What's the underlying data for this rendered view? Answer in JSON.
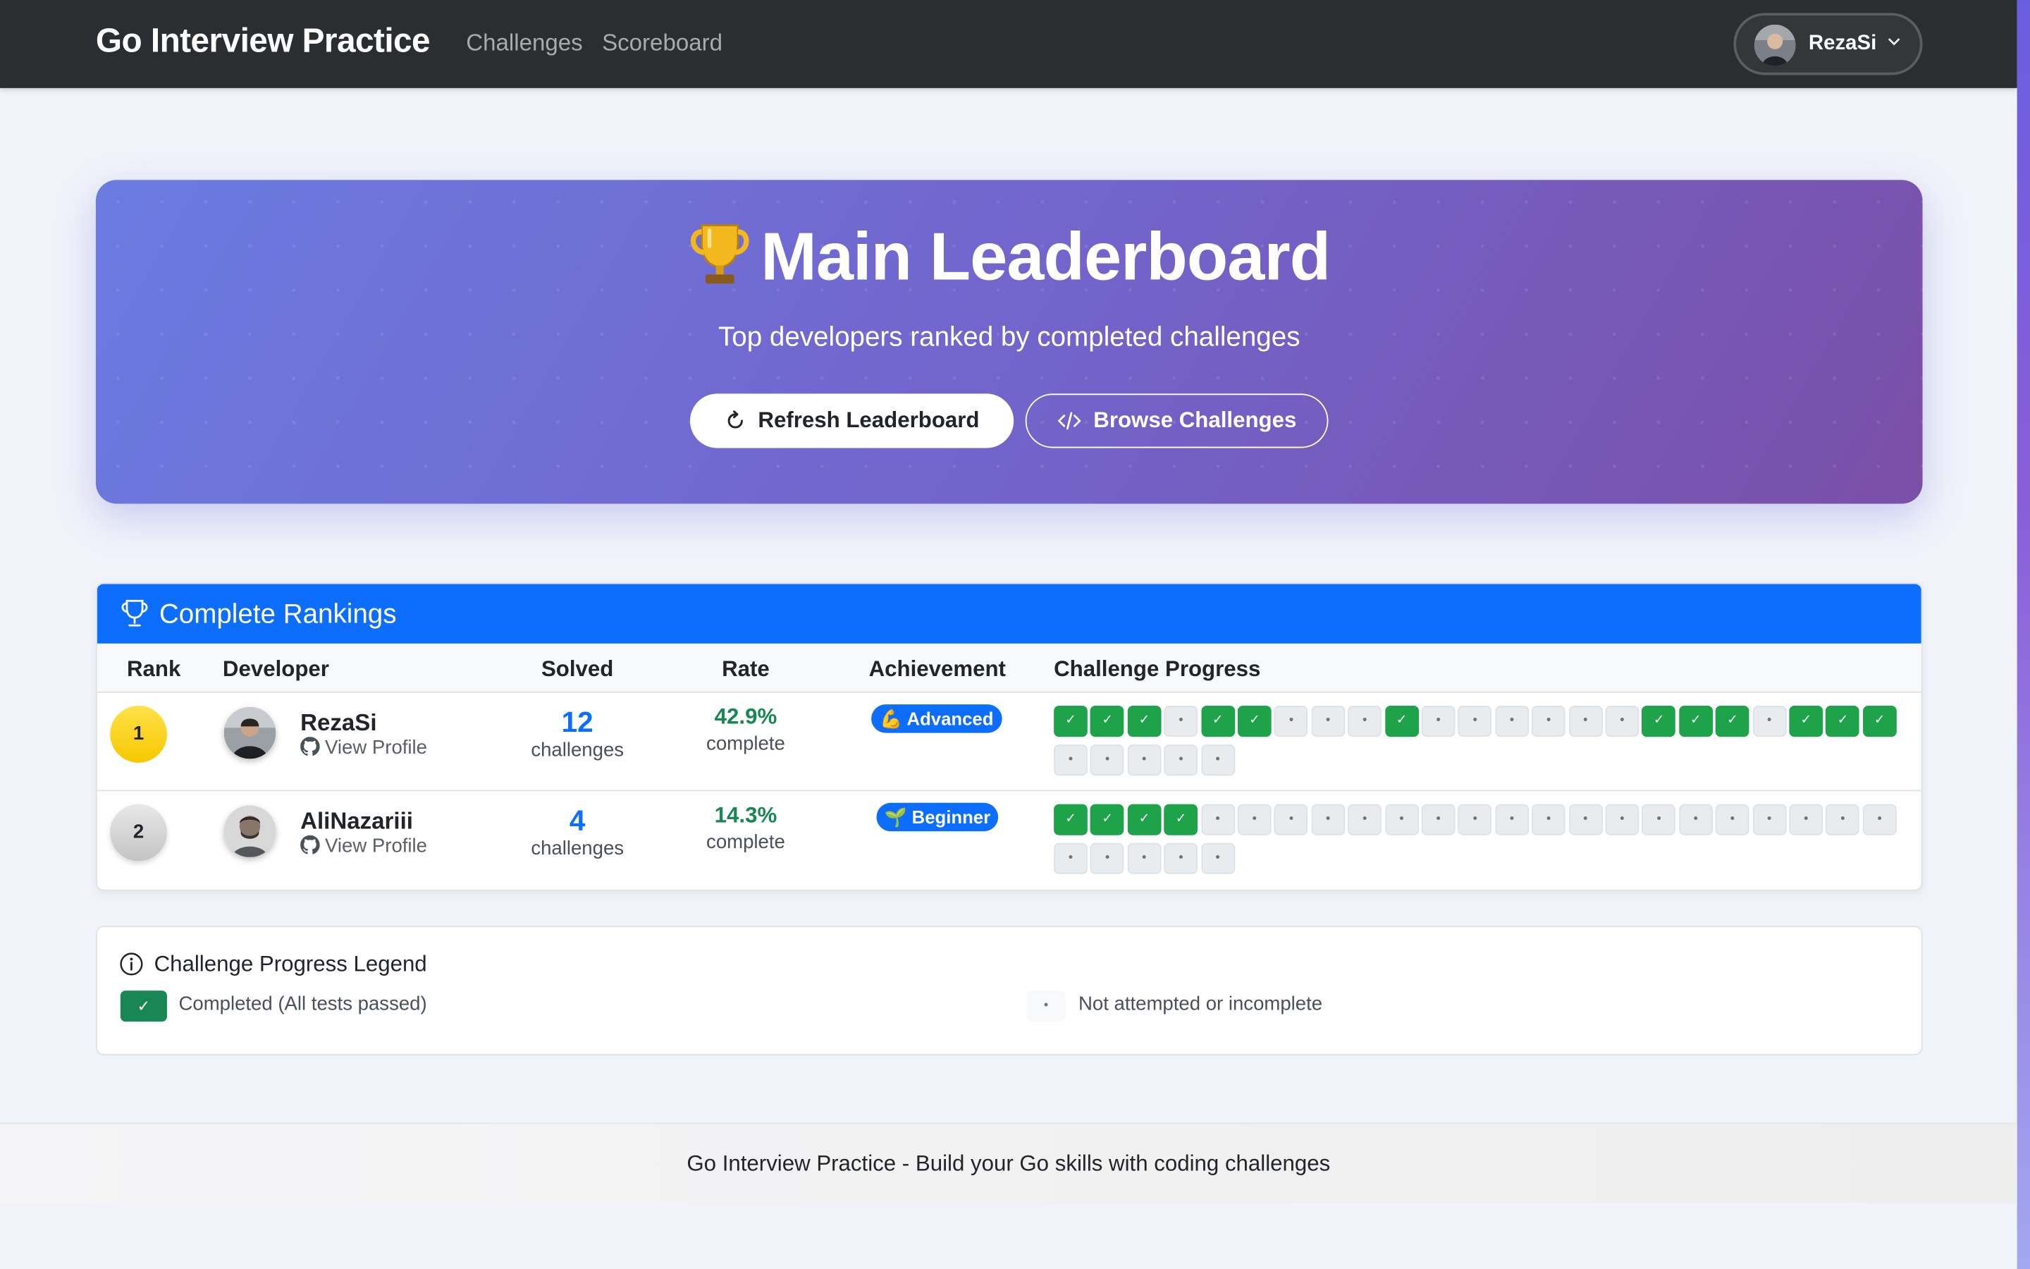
{
  "navbar": {
    "brand": "Go Interview Practice",
    "links": [
      "Challenges",
      "Scoreboard"
    ],
    "user": {
      "name": "RezaSi"
    }
  },
  "hero": {
    "emoji": "🏆",
    "title": "Main Leaderboard",
    "subtitle": "Top developers ranked by completed challenges",
    "refresh_label": "Refresh Leaderboard",
    "browse_label": "Browse Challenges"
  },
  "rankings": {
    "title": "Complete Rankings",
    "columns": {
      "rank": "Rank",
      "developer": "Developer",
      "solved": "Solved",
      "rate": "Rate",
      "achievement": "Achievement",
      "progress": "Challenge Progress"
    },
    "rows": [
      {
        "rank": "1",
        "name": "RezaSi",
        "profile_label": "View Profile",
        "solved": "12",
        "solved_unit": "challenges",
        "rate": "42.9%",
        "rate_unit": "complete",
        "achievement": "💪 Advanced",
        "progress": [
          1,
          1,
          1,
          0,
          1,
          1,
          0,
          0,
          0,
          1,
          0,
          0,
          0,
          0,
          0,
          0,
          1,
          1,
          1,
          0,
          1,
          1,
          1,
          0,
          0,
          0,
          0,
          0
        ]
      },
      {
        "rank": "2",
        "name": "AliNazariii",
        "profile_label": "View Profile",
        "solved": "4",
        "solved_unit": "challenges",
        "rate": "14.3%",
        "rate_unit": "complete",
        "achievement": "🌱 Beginner",
        "progress": [
          1,
          1,
          1,
          1,
          0,
          0,
          0,
          0,
          0,
          0,
          0,
          0,
          0,
          0,
          0,
          0,
          0,
          0,
          0,
          0,
          0,
          0,
          0,
          0,
          0,
          0,
          0,
          0
        ]
      }
    ]
  },
  "legend": {
    "title": "Challenge Progress Legend",
    "done_symbol": "✓",
    "done_label": "Completed (All tests passed)",
    "todo_symbol": "•",
    "todo_label": "Not attempted or incomplete"
  },
  "footer": {
    "text": "Go Interview Practice - Build your Go skills with coding challenges"
  },
  "colors": {
    "navbar": "#2b2e31",
    "primary": "#0d6efd",
    "success": "#198754",
    "gold": "#f7c800",
    "silver": "#c4c4c4"
  }
}
